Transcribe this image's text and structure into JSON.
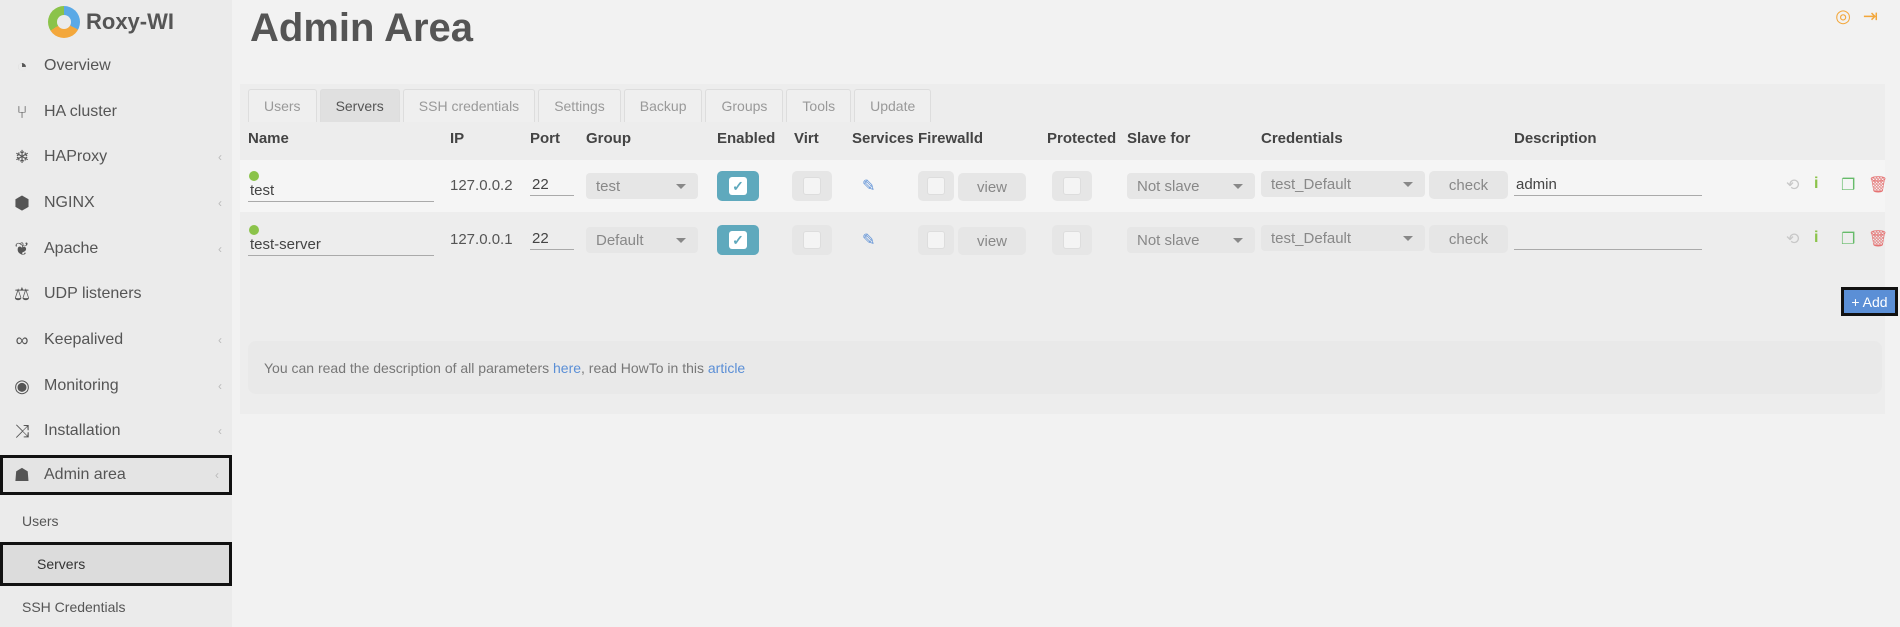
{
  "app": {
    "name": "Roxy-WI"
  },
  "sidebar": {
    "items": [
      {
        "label": "Overview",
        "icon": "overview-icon"
      },
      {
        "label": "HA cluster",
        "icon": "branch-icon"
      },
      {
        "label": "HAProxy",
        "icon": "haproxy-icon"
      },
      {
        "label": "NGINX",
        "icon": "nginx-icon"
      },
      {
        "label": "Apache",
        "icon": "feather-icon"
      },
      {
        "label": "UDP listeners",
        "icon": "scales-icon"
      },
      {
        "label": "Keepalived",
        "icon": "infinity-icon"
      },
      {
        "label": "Monitoring",
        "icon": "eye-icon"
      },
      {
        "label": "Installation",
        "icon": "shuffle-icon"
      },
      {
        "label": "Admin area",
        "icon": "spy-icon"
      }
    ],
    "subitems": [
      {
        "label": "Users"
      },
      {
        "label": "Servers"
      },
      {
        "label": "SSH Credentials"
      }
    ]
  },
  "page": {
    "title": "Admin Area"
  },
  "tabs": [
    "Users",
    "Servers",
    "SSH credentials",
    "Settings",
    "Backup",
    "Groups",
    "Tools",
    "Update"
  ],
  "table": {
    "headers": {
      "name": "Name",
      "ip": "IP",
      "port": "Port",
      "group": "Group",
      "enabled": "Enabled",
      "virt": "Virt",
      "services": "Services",
      "firewalld": "Firewalld",
      "protected": "Protected",
      "slave_for": "Slave for",
      "credentials": "Credentials",
      "description": "Description"
    },
    "rows": [
      {
        "name": "test",
        "ip": "127.0.0.2",
        "port": "22",
        "group": "test",
        "enabled": true,
        "virt": false,
        "firewalld_btn": "view",
        "protected": false,
        "slave_for": "Not slave",
        "credentials": "test_Default",
        "check_btn": "check",
        "description": "admin"
      },
      {
        "name": "test-server",
        "ip": "127.0.0.1",
        "port": "22",
        "group": "Default",
        "enabled": true,
        "virt": false,
        "firewalld_btn": "view",
        "protected": false,
        "slave_for": "Not slave",
        "credentials": "test_Default",
        "check_btn": "check",
        "description": ""
      }
    ]
  },
  "add_button": "+ Add",
  "info": {
    "text1": "You can read the description of all parameters ",
    "link1": "here",
    "text2": ", read HowTo in this ",
    "link2": "article"
  },
  "colors": {
    "accent": "#5b8fd6",
    "toggle": "#5fa9bd",
    "status_ok": "#8bc34a",
    "header_icons": "#f3a73b"
  }
}
